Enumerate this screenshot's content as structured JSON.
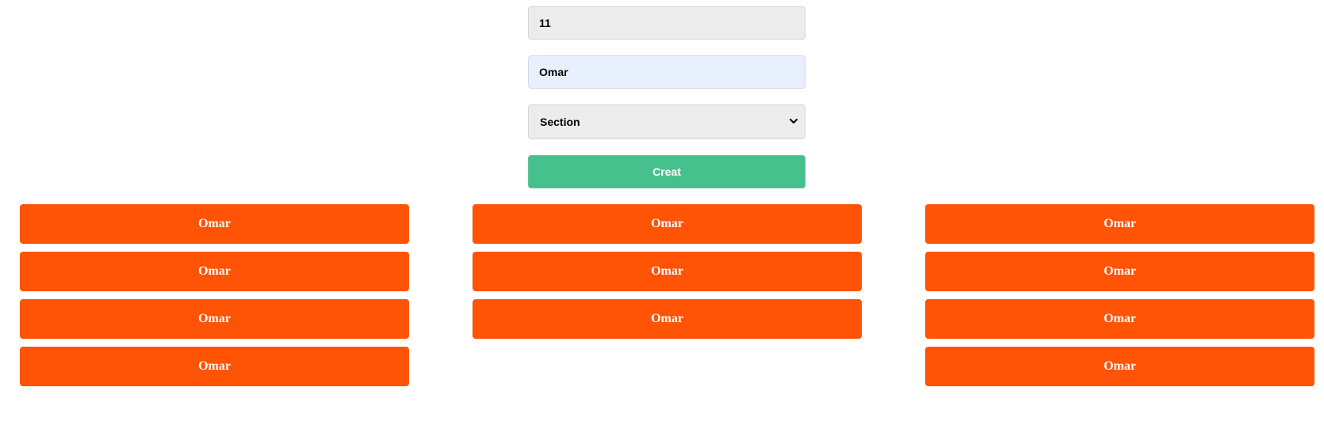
{
  "form": {
    "id_value": "11",
    "name_value": "Omar",
    "section_select": {
      "selected": "Section",
      "options": [
        "Section"
      ]
    },
    "create_label": "Creat"
  },
  "columns": [
    {
      "cards": [
        {
          "label": "Omar"
        },
        {
          "label": "Omar"
        },
        {
          "label": "Omar"
        },
        {
          "label": "Omar"
        }
      ]
    },
    {
      "cards": [
        {
          "label": "Omar"
        },
        {
          "label": "Omar"
        },
        {
          "label": "Omar"
        }
      ]
    },
    {
      "cards": [
        {
          "label": "Omar"
        },
        {
          "label": "Omar"
        },
        {
          "label": "Omar"
        },
        {
          "label": "Omar"
        }
      ]
    }
  ],
  "icons": {
    "select_arrow": "chevron-down-icon"
  },
  "colors": {
    "card_background": "#ff5305",
    "create_button": "#46c18d",
    "input_background": "#ececec",
    "autofill_background": "#e8f0fe"
  }
}
